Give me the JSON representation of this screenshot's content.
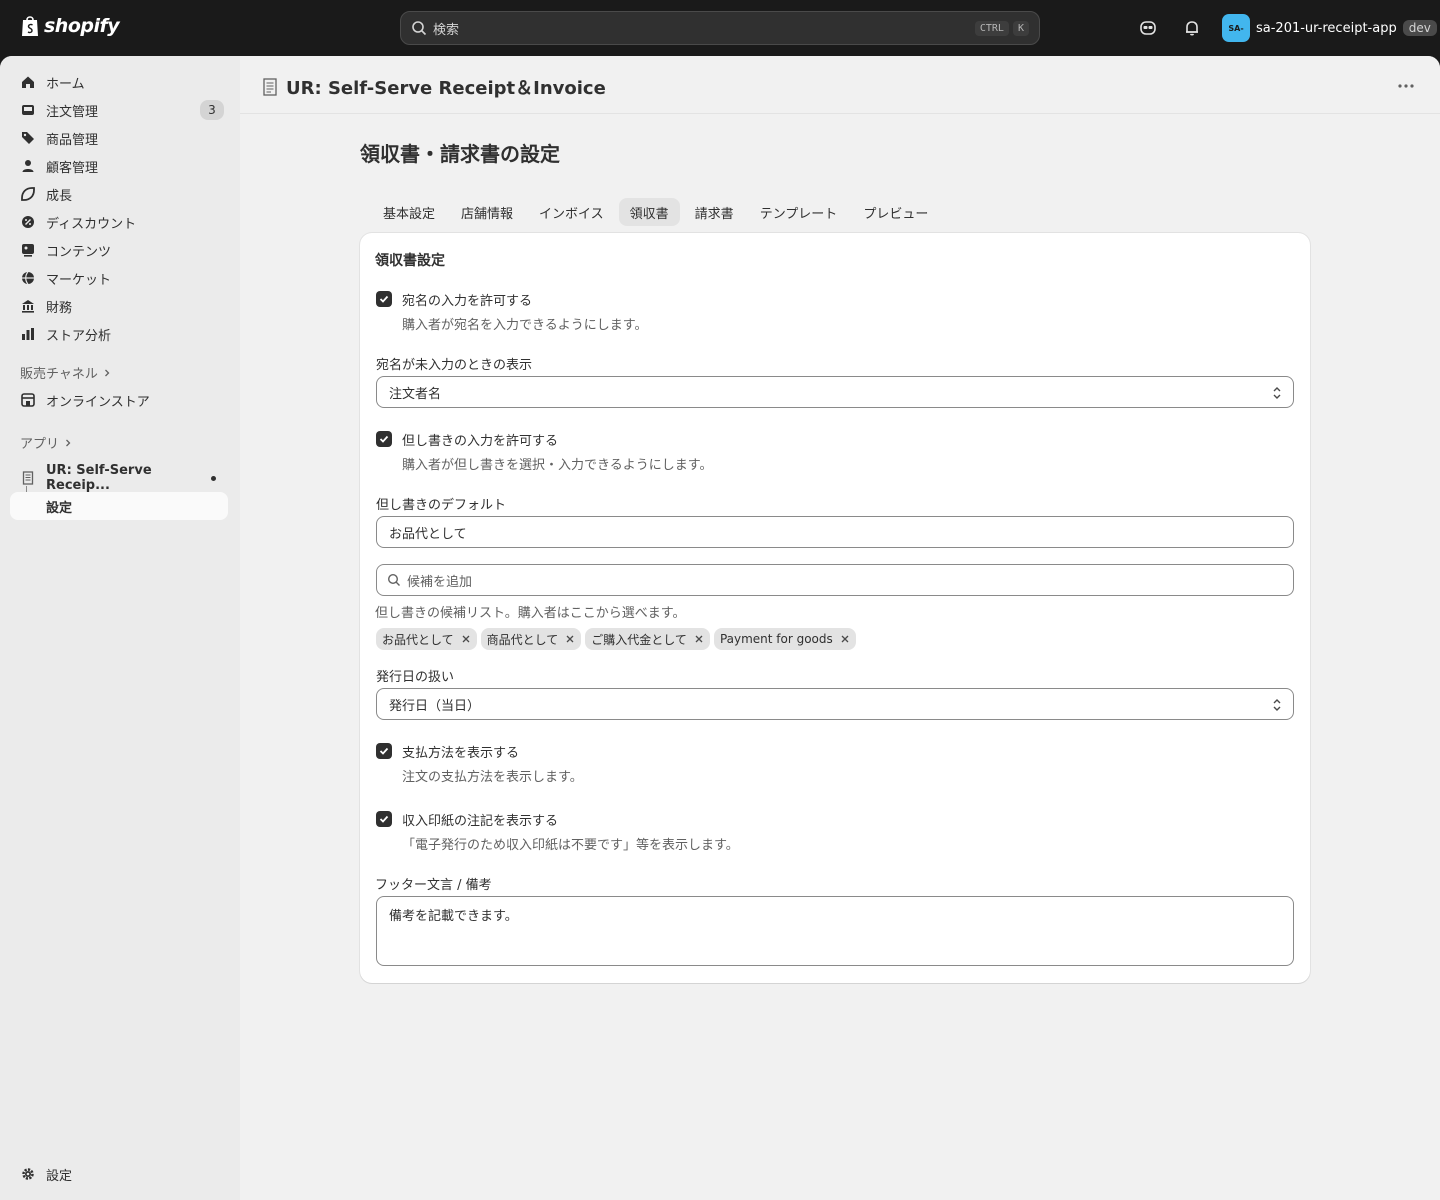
{
  "topbar": {
    "logo_text": "shopify",
    "search_placeholder": "検索",
    "shortcut_keys": [
      "CTRL",
      "K"
    ],
    "store_avatar": "SA-",
    "store_name": "sa-201-ur-receipt-app",
    "store_badge": "dev"
  },
  "sidebar": {
    "items": [
      {
        "label": "ホーム",
        "icon": "home-icon"
      },
      {
        "label": "注文管理",
        "icon": "orders-icon",
        "count": "3"
      },
      {
        "label": "商品管理",
        "icon": "tag-icon"
      },
      {
        "label": "顧客管理",
        "icon": "person-icon"
      },
      {
        "label": "成長",
        "icon": "growth-icon"
      },
      {
        "label": "ディスカウント",
        "icon": "discount-icon"
      },
      {
        "label": "コンテンツ",
        "icon": "content-icon"
      },
      {
        "label": "マーケット",
        "icon": "globe-icon"
      },
      {
        "label": "財務",
        "icon": "bank-icon"
      },
      {
        "label": "ストア分析",
        "icon": "chart-icon"
      }
    ],
    "sales_channels_label": "販売チャネル",
    "online_store_label": "オンラインストア",
    "apps_label": "アプリ",
    "app_name": "UR: Self-Serve Receip...",
    "app_sub_label": "設定",
    "settings_label": "設定"
  },
  "main": {
    "app_title": "UR: Self-Serve Receipt＆Invoice",
    "page_heading": "領収書・請求書の設定",
    "tabs": [
      "基本設定",
      "店舗情報",
      "インボイス",
      "領収書",
      "請求書",
      "テンプレート",
      "プレビュー"
    ],
    "active_tab": "領収書"
  },
  "form": {
    "card_title": "領収書設定",
    "allow_addressee_label": "宛名の入力を許可する",
    "allow_addressee_help": "購入者が宛名を入力できるようにします。",
    "allow_addressee_checked": true,
    "empty_addressee_label": "宛名が未入力のときの表示",
    "empty_addressee_value": "注文者名",
    "allow_proviso_label": "但し書きの入力を許可する",
    "allow_proviso_help": "購入者が但し書きを選択・入力できるようにします。",
    "allow_proviso_checked": true,
    "proviso_default_label": "但し書きのデフォルト",
    "proviso_default_value": "お品代として",
    "candidate_placeholder": "候補を追加",
    "candidate_help": "但し書きの候補リスト。購入者はここから選べます。",
    "candidates": [
      "お品代として",
      "商品代として",
      "ご購入代金として",
      "Payment for goods"
    ],
    "issue_date_label": "発行日の扱い",
    "issue_date_value": "発行日（当日）",
    "show_payment_label": "支払方法を表示する",
    "show_payment_help": "注文の支払方法を表示します。",
    "show_payment_checked": true,
    "show_stamp_label": "収入印紙の注記を表示する",
    "show_stamp_help": "「電子発行のため収入印紙は不要です」等を表示します。",
    "show_stamp_checked": true,
    "footer_label": "フッター文言 / 備考",
    "footer_value": "備考を記載できます。"
  }
}
